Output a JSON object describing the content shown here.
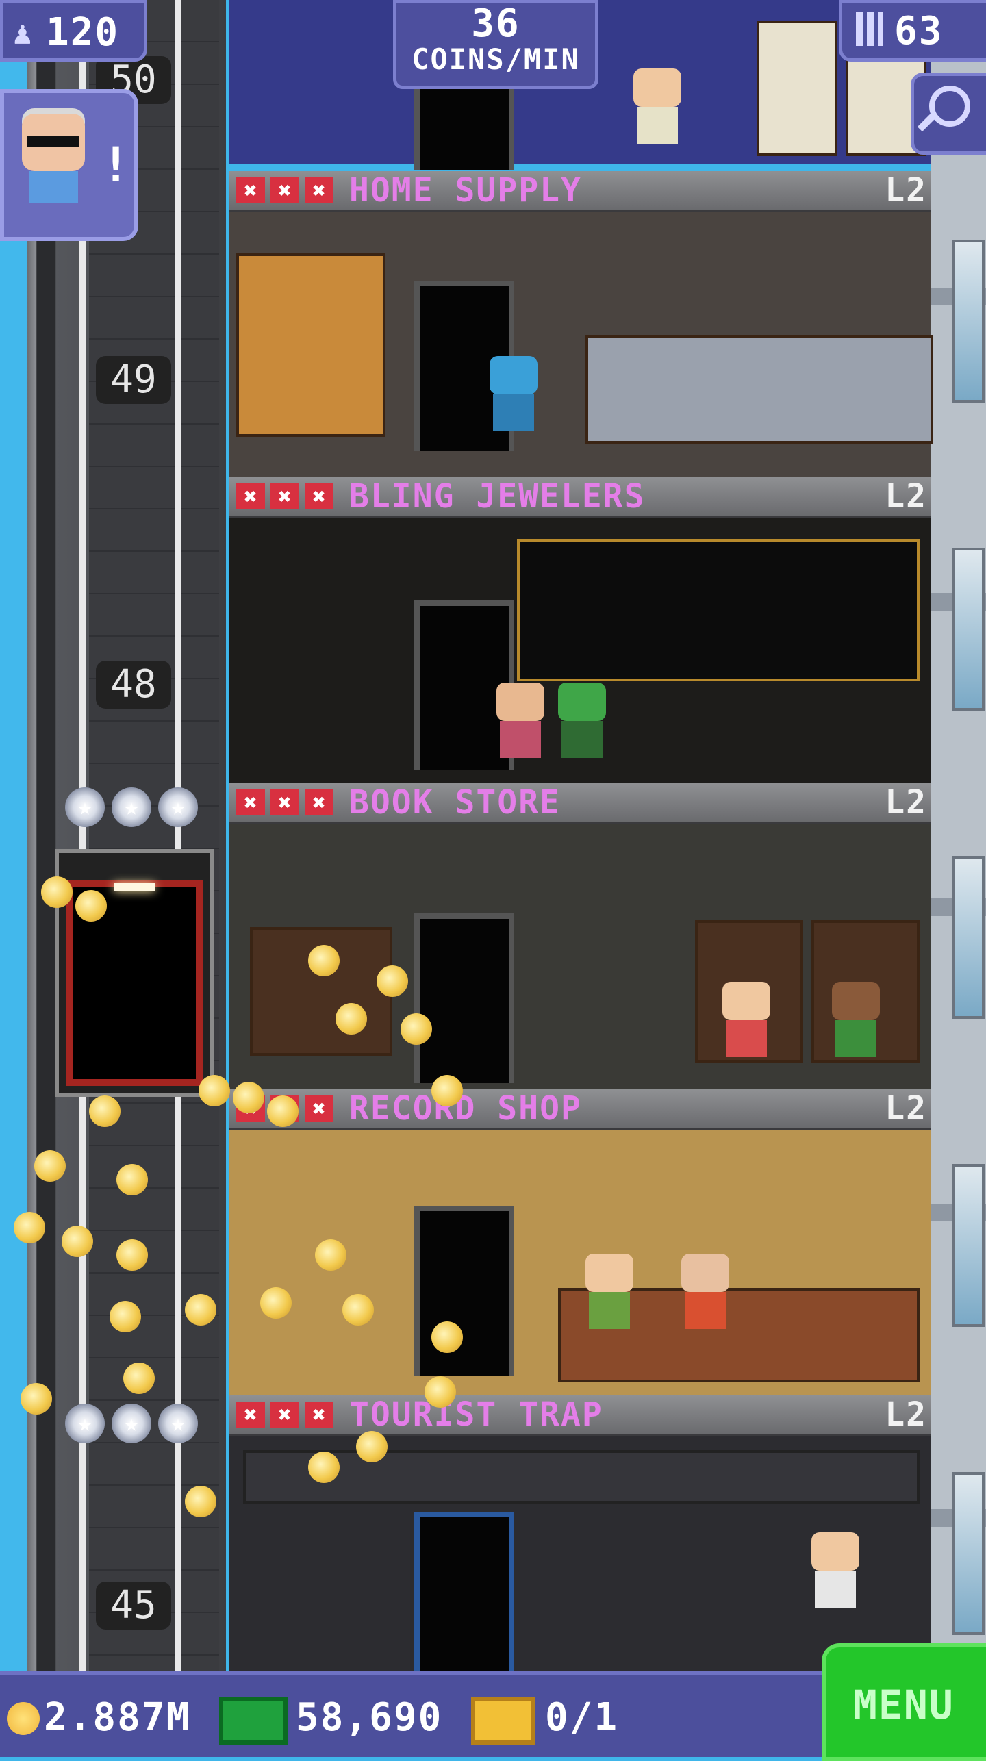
{
  "hud": {
    "population": "120",
    "coins_per_min_value": "36",
    "coins_per_min_label": "COINS/MIN",
    "floor_count": "63"
  },
  "vip": {
    "alert": "!"
  },
  "elevator": {
    "floor_numbers": [
      "50",
      "49",
      "48",
      "45"
    ]
  },
  "floors": [
    {
      "name": "HOME SUPPLY",
      "level": "L2",
      "stock_marks": [
        "✖",
        "✖",
        "✖"
      ]
    },
    {
      "name": "BLING JEWELERS",
      "level": "L2",
      "stock_marks": [
        "✖",
        "✖",
        "✖"
      ]
    },
    {
      "name": "BOOK STORE",
      "level": "L2",
      "stock_marks": [
        "✖",
        "✖",
        "✖"
      ]
    },
    {
      "name": "RECORD SHOP",
      "level": "L2",
      "stock_marks": [
        "✖",
        "✖",
        "✖"
      ]
    },
    {
      "name": "TOURIST TRAP",
      "level": "L2",
      "stock_marks": [
        "✖",
        "✖",
        "✖"
      ]
    }
  ],
  "bottom_bar": {
    "coins": "2.887M",
    "bux": "58,690",
    "tickets": "0/1",
    "menu_label": "MENU"
  },
  "colors": {
    "hud_panel": "#4d4f9e",
    "store_name": "#e47ee8",
    "stock_mark": "#d83040",
    "menu_green": "#23c62a",
    "sky": "#3fb6ea"
  },
  "icons": {
    "population": "person-icon",
    "floors": "building-icon",
    "search": "magnifier-icon",
    "coin": "coin-icon",
    "bux": "bux-bill-icon",
    "ticket": "ticket-icon"
  }
}
